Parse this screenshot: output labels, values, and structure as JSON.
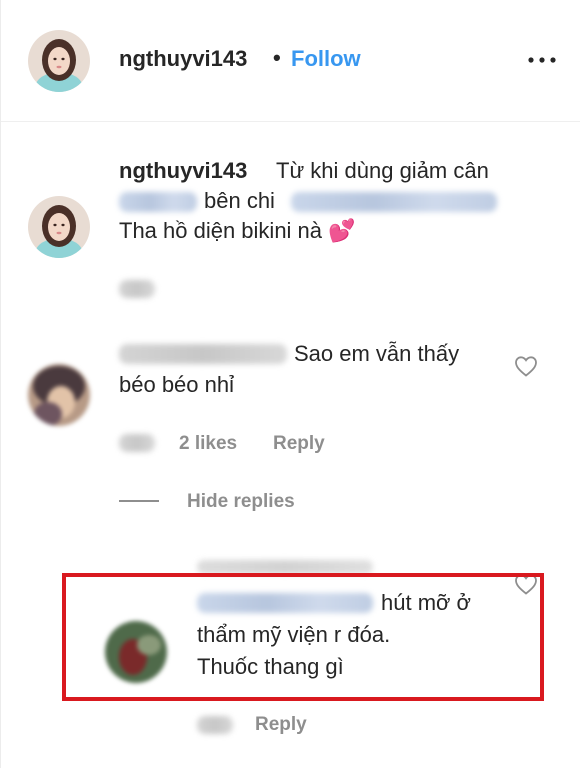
{
  "header": {
    "username": "ngthuyvi143",
    "separator": "•",
    "follow_label": "Follow"
  },
  "caption": {
    "username": "ngthuyvi143",
    "line1": "Từ khi dùng giảm cân",
    "line2": "bên chi",
    "line3": "Tha hồ diện bikini nà 💕"
  },
  "comment": {
    "line1": "Sao em vẫn thấy",
    "line2": "béo béo nhỉ",
    "likes": "2 likes",
    "reply_label": "Reply",
    "hide_replies_label": "Hide replies"
  },
  "reply": {
    "line1": "hút mỡ ở",
    "line2": "thẩm mỹ viện r đóa.",
    "line3": "Thuốc thang gì",
    "reply_label": "Reply"
  },
  "colors": {
    "link_blue": "#3897f0",
    "muted": "#8e8e8e",
    "highlight_red": "#d9191f"
  },
  "icons": [
    "avatar",
    "more-horizontal-icon",
    "heart-outline-icon",
    "emoji-hearts-icon"
  ]
}
